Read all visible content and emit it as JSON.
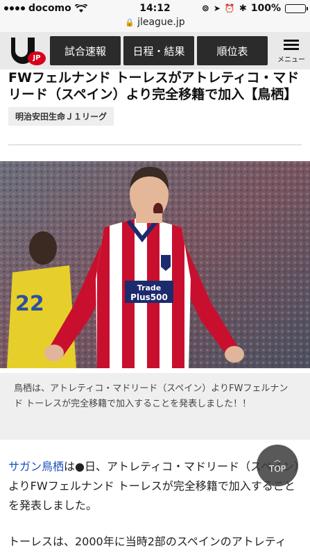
{
  "status_bar": {
    "carrier": "docomo",
    "time": "14:12",
    "battery": "100%"
  },
  "url": "jleague.jp",
  "header": {
    "logo_text": "JP",
    "nav": [
      "試合速報",
      "日程・結果",
      "順位表"
    ],
    "menu_label": "メニュー"
  },
  "article": {
    "title": "FWフェルナンド トーレスがアトレティコ・マドリード（スペイン）より完全移籍で加入【鳥栖】",
    "title_line1": "FWフェルナンド トーレスがアトレティコ・マド",
    "title_line2": "リード（スペイン）より完全移籍で加入【鳥栖】",
    "tag": "明治安田生命Ｊ１リーグ",
    "photo_text": {
      "sponsor_line1": "Trade",
      "sponsor_line2": "Plus500",
      "bg_number": "22"
    },
    "caption": "鳥栖は、アトレティコ・マドリード（スペイン）よりFWフェルナンド トーレスが完全移籍で加入することを発表しました！！",
    "body_link": "サガン鳥栖",
    "body_para1": "は●日、アトレティコ・マドリード（スペイン）よりFWフェルナンド トーレスが完全移籍で加入することを発表しました。",
    "body_para2": "トーレスは、2000年に当時2部のスペインのアトレティ"
  },
  "top_button": "TOP"
}
